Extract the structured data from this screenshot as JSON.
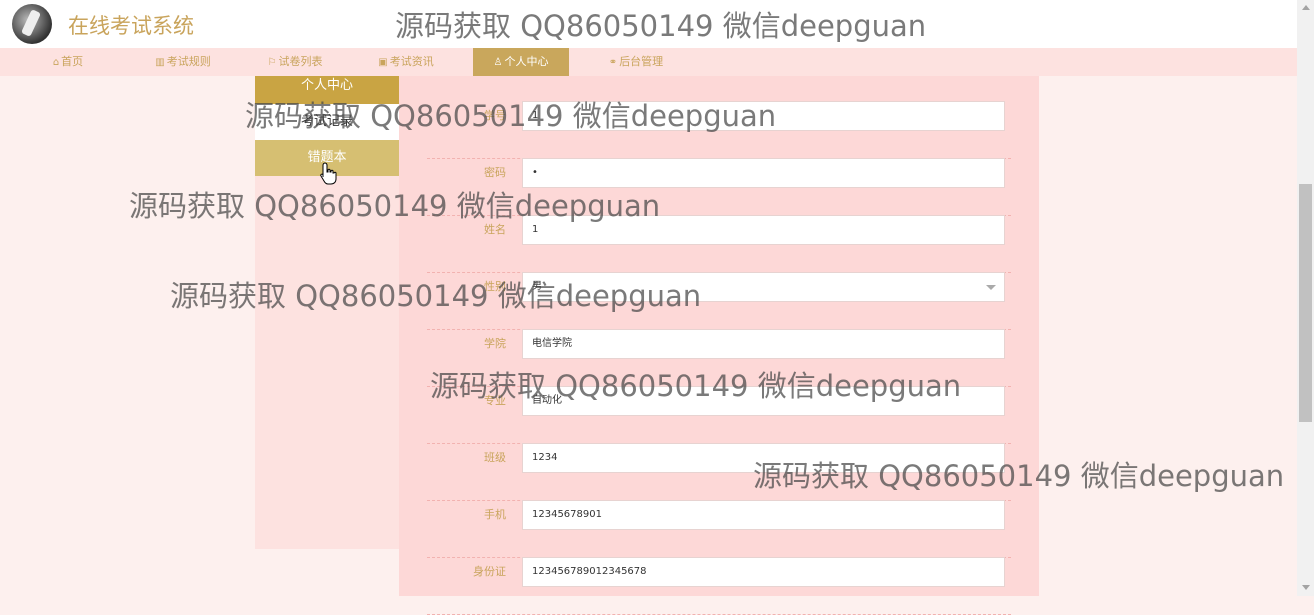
{
  "header": {
    "title": "在线考试系统"
  },
  "nav": {
    "items": [
      {
        "icon": "⌂",
        "label": "首页"
      },
      {
        "icon": "▥",
        "label": "考试规则"
      },
      {
        "icon": "⚐",
        "label": "试卷列表"
      },
      {
        "icon": "▣",
        "label": "考试资讯"
      },
      {
        "icon": "♙",
        "label": "个人中心",
        "active": true
      },
      {
        "icon": "⚭",
        "label": "后台管理"
      }
    ]
  },
  "sidebar": {
    "title": "个人中心",
    "items": [
      {
        "label": "考试记录"
      },
      {
        "label": "错题本"
      }
    ]
  },
  "form": {
    "fields": [
      {
        "label": "学号",
        "value": "1"
      },
      {
        "label": "密码",
        "value": "•"
      },
      {
        "label": "姓名",
        "value": "1"
      },
      {
        "label": "性别",
        "value": "男"
      },
      {
        "label": "学院",
        "value": "电信学院"
      },
      {
        "label": "专业",
        "value": "自动化"
      },
      {
        "label": "班级",
        "value": "1234"
      },
      {
        "label": "手机",
        "value": "12345678901"
      },
      {
        "label": "身份证",
        "value": "123456789012345678"
      }
    ]
  },
  "watermark": {
    "text": "源码获取 QQ86050149 微信deepguan"
  },
  "colors": {
    "accent": "#c9a45c",
    "nav_bg": "#fde2e0",
    "panel_bg": "#fdd8d7",
    "active": "#c9a75c"
  }
}
